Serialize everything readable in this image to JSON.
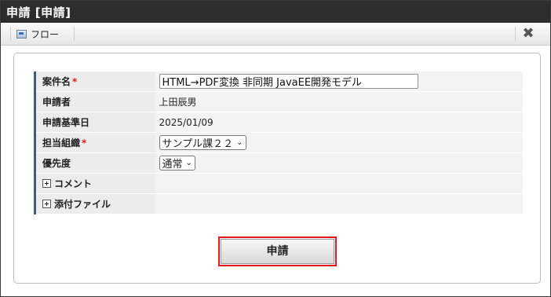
{
  "window": {
    "title": "申請 [申請]"
  },
  "toolbar": {
    "flow_label": "フロー",
    "close_icon": "close-icon"
  },
  "form": {
    "subject": {
      "label": "案件名",
      "required_mark": "*",
      "value": "HTML→PDF変換 非同期 JavaEE開発モデル"
    },
    "applicant": {
      "label": "申請者",
      "value": "上田辰男"
    },
    "base_date": {
      "label": "申請基準日",
      "value": "2025/01/09"
    },
    "organization": {
      "label": "担当組織",
      "required_mark": "*",
      "selected": "サンプル課２２"
    },
    "priority": {
      "label": "優先度",
      "selected": "通常"
    },
    "comment": {
      "label": "コメント"
    },
    "attachment": {
      "label": "添付ファイル"
    }
  },
  "actions": {
    "apply_label": "申請"
  },
  "colors": {
    "titlebar": "#2d2d2d",
    "label_accent": "#3f5a80",
    "highlight": "#e01b1b",
    "required": "#d21e1e"
  }
}
